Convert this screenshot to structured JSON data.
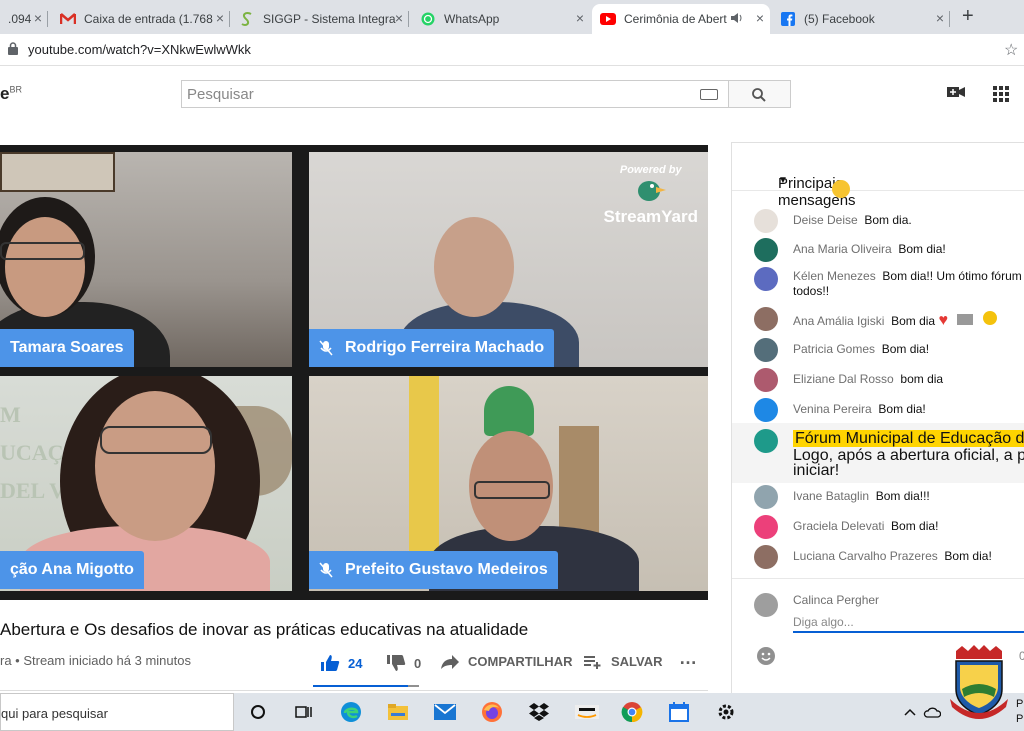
{
  "browser": {
    "tabs": [
      {
        "title": ".094",
        "favicon": "generic",
        "close": "×"
      },
      {
        "title": "Caixa de entrada (1.768",
        "favicon": "gmail-icon",
        "close": "×"
      },
      {
        "title": "SIGGP - Sistema Integra",
        "favicon": "siggp-icon",
        "close": "×"
      },
      {
        "title": "WhatsApp",
        "favicon": "whatsapp-icon",
        "close": "×"
      },
      {
        "title": "Cerimônia de Abert",
        "favicon": "youtube-icon",
        "close": "×",
        "active": true
      },
      {
        "title": "(5) Facebook",
        "favicon": "facebook-icon",
        "close": "×"
      }
    ],
    "new_tab": "+",
    "url": "youtube.com/watch?v=XNkwEwlwWkk"
  },
  "youtube": {
    "logo_text": "e",
    "logo_region": "BR",
    "search_placeholder": "Pesquisar"
  },
  "video": {
    "participants": [
      {
        "name": "Tamara Soares"
      },
      {
        "name": "Rodrigo Ferreira Machado"
      },
      {
        "name": "ção Ana Migotto"
      },
      {
        "name": "Prefeito Gustavo Medeiros"
      }
    ],
    "branding_powered": "Powered by",
    "branding_name": "StreamYard",
    "title": "Abertura e Os desafios de inovar as práticas educativas na atualidade",
    "meta": "ra • Stream iniciado há 3 minutos",
    "likes": "24",
    "dislikes": "0",
    "like_ratio": 0.9,
    "share_label": "COMPARTILHAR",
    "save_label": "SALVAR",
    "more": "…"
  },
  "chat": {
    "header": "Principais mensagens",
    "messages": [
      {
        "author": "Deise Deise",
        "text": "Bom dia.",
        "color": "#e6e0da"
      },
      {
        "author": "Ana Maria Oliveira",
        "text": "Bom dia!",
        "color": "#1e6e5e"
      },
      {
        "author": "Kélen Menezes",
        "text": "Bom dia!! Um ótimo fórum",
        "text2": "todos!!",
        "color": "#5c6bc0"
      },
      {
        "author": "Ana Amália Igiski",
        "text": "Bom dia",
        "color": "#8d6e63"
      },
      {
        "author": "Patricia Gomes",
        "text": "Bom dia!",
        "color": "#546e7a"
      },
      {
        "author": "Eliziane Dal Rosso",
        "text": "bom dia",
        "color": "#ad5a6e"
      },
      {
        "author": "Venina Pereira",
        "text": "Bom dia!",
        "color": "#1e88e5"
      },
      {
        "author": "Ivane Bataglin",
        "text": "Bom dia!!!",
        "color": "#90a4ae"
      },
      {
        "author": "Graciela Delevati",
        "text": "Bom dia!",
        "color": "#ec407a"
      },
      {
        "author": "Luciana Carvalho Prazeres",
        "text": "Bom dia!",
        "color": "#8d6e63"
      }
    ],
    "pinned": {
      "highlight": "Fórum Municipal de Educação de Manoel",
      "line1": "Logo, após a abertura oficial, a primeira Li",
      "line2": "iniciar!"
    },
    "current_user": "Calinca Pergher",
    "input_placeholder": "Diga algo...",
    "counter": "0"
  },
  "taskbar": {
    "search_text": "qui para pesquisar",
    "tray_text_1": "P",
    "tray_text_2": "P"
  }
}
